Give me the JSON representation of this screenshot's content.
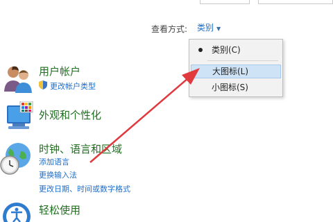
{
  "view": {
    "label": "查看方式:",
    "selected": "类别",
    "options": [
      {
        "label": "类别(C)",
        "checked": true
      },
      {
        "label": "大图标(L)",
        "highlighted": true
      },
      {
        "label": "小图标(S)"
      }
    ]
  },
  "categories": {
    "user": {
      "title": "用户帐户",
      "links": [
        "更改帐户类型"
      ]
    },
    "appearance": {
      "title": "外观和个性化"
    },
    "clock": {
      "title": "时钟、语言和区域",
      "links": [
        "添加语言",
        "更换输入法",
        "更改日期、时间或数字格式"
      ]
    },
    "ease": {
      "title": "轻松使用"
    }
  },
  "annotation": {
    "arrow_color": "#e0393e"
  },
  "colors": {
    "link": "#1e6ec8",
    "category_title": "#1f6f1f",
    "highlight": "#cfe3f7"
  }
}
